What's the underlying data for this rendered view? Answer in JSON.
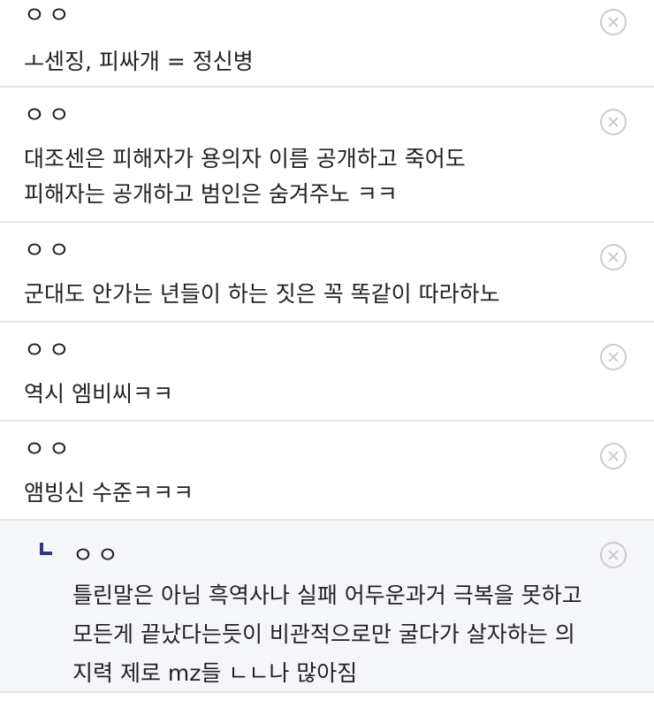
{
  "comments": [
    {
      "author": "ㅇㅇ",
      "lines": [
        "ㅗ센징, 피싸개 = 정신병"
      ]
    },
    {
      "author": "ㅇㅇ",
      "lines": [
        "대조센은 피해자가 용의자 이름 공개하고 죽어도",
        "피해자는 공개하고 범인은 숨겨주노 ㅋㅋ"
      ]
    },
    {
      "author": "ㅇㅇ",
      "lines": [
        "군대도 안가는 년들이 하는 짓은 꼭 똑같이 따라하노"
      ]
    },
    {
      "author": "ㅇㅇ",
      "lines": [
        "역시 엠비씨ㅋㅋ"
      ]
    },
    {
      "author": "ㅇㅇ",
      "lines": [
        "앰빙신 수준ㅋㅋㅋ"
      ]
    }
  ],
  "reply": {
    "author": "ㅇㅇ",
    "lines": [
      "틀린말은 아님 흑역사나 실패 어두운과거 극복을 못하고",
      "모든게 끝났다는듯이 비관적으로만 굴다가 살자하는 의",
      "지력 제로 mz들 ㄴㄴ나 많아짐"
    ]
  },
  "icons": {
    "delete": "close-circle-icon",
    "reply_marker": "reply-arrow-icon"
  },
  "colors": {
    "divider": "#e4e4e4",
    "reply_background": "#f5f6fa",
    "reply_marker": "#2f3a73",
    "delete_icon": "#cccccc"
  }
}
